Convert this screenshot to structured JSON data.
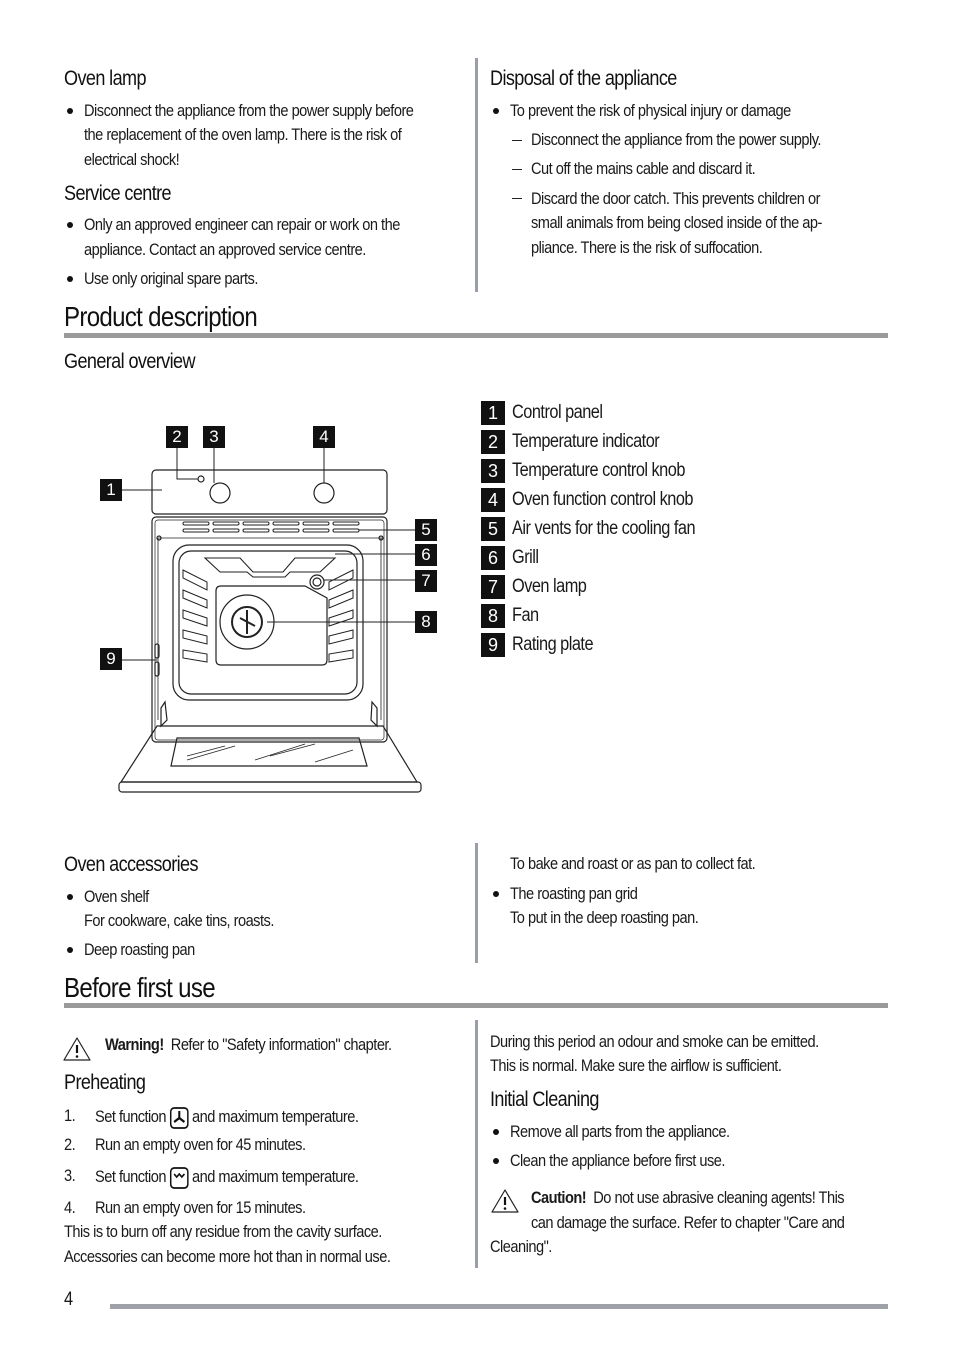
{
  "safety": {
    "oven_lamp": {
      "heading": "Oven lamp",
      "bullets": [
        [
          "Disconnect the appliance from the power supply before",
          "the replacement of the oven lamp. There is the risk of",
          "electrical shock!"
        ]
      ]
    },
    "service_centre": {
      "heading": "Service centre",
      "bullets": [
        [
          "Only an approved engineer can repair or work on the",
          "appliance. Contact an approved service centre."
        ],
        [
          "Use only original spare parts."
        ]
      ]
    },
    "disposal": {
      "heading": "Disposal of the appliance",
      "bullet": "To prevent the risk of physical injury or damage",
      "dashes": [
        [
          "Disconnect the appliance from the power supply."
        ],
        [
          "Cut off the mains cable and discard it."
        ],
        [
          "Discard the door catch. This prevents children or",
          "small animals from being closed inside of the ap-",
          "pliance. There is the risk of suffocation."
        ]
      ]
    }
  },
  "product_description": {
    "title": "Product description",
    "general_overview": {
      "heading": "General overview",
      "legend": [
        {
          "num": "1",
          "label": "Control panel"
        },
        {
          "num": "2",
          "label": "Temperature indicator"
        },
        {
          "num": "3",
          "label": "Temperature control knob"
        },
        {
          "num": "4",
          "label": "Oven function control knob"
        },
        {
          "num": "5",
          "label": "Air vents for the cooling fan"
        },
        {
          "num": "6",
          "label": "Grill"
        },
        {
          "num": "7",
          "label": "Oven lamp"
        },
        {
          "num": "8",
          "label": "Fan"
        },
        {
          "num": "9",
          "label": "Rating plate"
        }
      ]
    },
    "accessories": {
      "heading": "Oven accessories",
      "items": [
        {
          "name": "Oven shelf",
          "desc": "For cookware, cake tins, roasts."
        },
        {
          "name": "Deep roasting pan",
          "desc": "To bake and roast or as pan to collect fat."
        },
        {
          "name": "The roasting pan grid",
          "desc": "To put in the deep roasting pan."
        }
      ]
    }
  },
  "before_first_use": {
    "title": "Before first use",
    "warning": {
      "icon": "warning-triangle-icon",
      "label": "Warning!",
      "text": "Refer to \"Safety information\" chapter."
    },
    "preheating": {
      "heading": "Preheating",
      "steps": [
        {
          "num": "1.",
          "before": "Set function",
          "icon": "fan-function-icon",
          "after": "and maximum temperature."
        },
        {
          "num": "2.",
          "text": "Run an empty oven for 45 minutes."
        },
        {
          "num": "3.",
          "before": "Set function",
          "icon": "grill-function-icon",
          "after": "and maximum temperature."
        },
        {
          "num": "4.",
          "text": "Run an empty oven for 15 minutes."
        }
      ],
      "note": [
        "This is to burn off any residue from the cavity surface.",
        "Accessories can become more hot than in normal use."
      ]
    },
    "odour_note": [
      "During this period an odour and smoke can be emitted.",
      "This is normal. Make sure the airflow is sufficient."
    ],
    "initial_cleaning": {
      "heading": "Initial Cleaning",
      "bullets": [
        "Remove all parts from the appliance.",
        "Clean the appliance before first use."
      ]
    },
    "caution": {
      "icon": "warning-triangle-icon",
      "label": "Caution!",
      "lines": [
        "Do not use abrasive cleaning agents! This",
        "can damage the surface. Refer to chapter \"Care and",
        "Cleaning\"."
      ]
    }
  },
  "footer": {
    "page_number": "4"
  }
}
